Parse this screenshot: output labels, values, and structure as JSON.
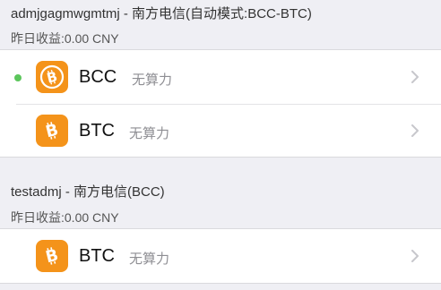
{
  "groups": [
    {
      "title": "admjgagmwgmtmj - 南方电信(自动模式:BCC-BTC)",
      "earnings": "昨日收益:0.00 CNY",
      "rows": [
        {
          "coin": "BCC",
          "status": "无算力",
          "icon": "bitcoin-cash-icon",
          "active": true
        },
        {
          "coin": "BTC",
          "status": "无算力",
          "icon": "bitcoin-icon",
          "active": false
        }
      ]
    },
    {
      "title": "testadmj - 南方电信(BCC)",
      "earnings": "昨日收益:0.00 CNY",
      "rows": [
        {
          "coin": "BTC",
          "status": "无算力",
          "icon": "bitcoin-icon",
          "active": false
        }
      ]
    }
  ],
  "colors": {
    "background": "#efeff4",
    "coin_orange": "#f4931a",
    "active_dot": "#5cc65c",
    "chevron": "#c7c7cc",
    "status_text": "#8e8e93"
  }
}
